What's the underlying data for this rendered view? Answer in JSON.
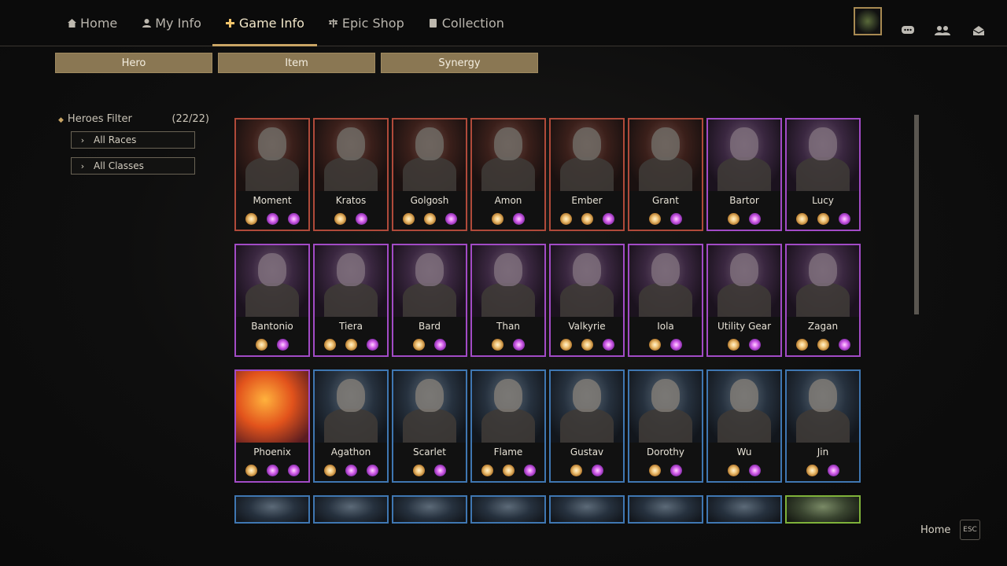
{
  "nav": {
    "items": [
      {
        "label": "Home",
        "icon": "home-icon"
      },
      {
        "label": "My Info",
        "icon": "user-icon"
      },
      {
        "label": "Game Info",
        "icon": "cross-icon",
        "active": true
      },
      {
        "label": "Epic Shop",
        "icon": "scale-icon"
      },
      {
        "label": "Collection",
        "icon": "book-icon"
      }
    ]
  },
  "subtabs": [
    "Hero",
    "Item",
    "Synergy"
  ],
  "filter": {
    "title": "Heroes Filter",
    "count": "(22/22)",
    "races": "All Races",
    "classes": "All Classes"
  },
  "heroes": [
    {
      "name": "Moment",
      "rarity": "red",
      "syn": [
        "o",
        "p",
        "p"
      ]
    },
    {
      "name": "Kratos",
      "rarity": "red",
      "syn": [
        "o",
        "p"
      ]
    },
    {
      "name": "Golgosh",
      "rarity": "red",
      "syn": [
        "o",
        "o",
        "p"
      ]
    },
    {
      "name": "Amon",
      "rarity": "red",
      "syn": [
        "o",
        "p"
      ]
    },
    {
      "name": "Ember",
      "rarity": "red",
      "syn": [
        "o",
        "o",
        "p"
      ]
    },
    {
      "name": "Grant",
      "rarity": "red",
      "syn": [
        "o",
        "p"
      ]
    },
    {
      "name": "Bartor",
      "rarity": "purple",
      "syn": [
        "o",
        "p"
      ]
    },
    {
      "name": "Lucy",
      "rarity": "purple",
      "syn": [
        "o",
        "o",
        "p"
      ]
    },
    {
      "name": "Bantonio",
      "rarity": "purple",
      "syn": [
        "o",
        "p"
      ]
    },
    {
      "name": "Tiera",
      "rarity": "purple",
      "syn": [
        "o",
        "o",
        "p"
      ]
    },
    {
      "name": "Bard",
      "rarity": "purple",
      "syn": [
        "o",
        "p"
      ]
    },
    {
      "name": "Than",
      "rarity": "purple",
      "syn": [
        "o",
        "p"
      ]
    },
    {
      "name": "Valkyrie",
      "rarity": "purple",
      "syn": [
        "o",
        "o",
        "p"
      ]
    },
    {
      "name": "Iola",
      "rarity": "purple",
      "syn": [
        "o",
        "p"
      ]
    },
    {
      "name": "Utility Gear",
      "rarity": "purple",
      "syn": [
        "o",
        "p"
      ]
    },
    {
      "name": "Zagan",
      "rarity": "purple",
      "syn": [
        "o",
        "o",
        "p"
      ]
    },
    {
      "name": "Phoenix",
      "rarity": "purple",
      "syn": [
        "o",
        "p",
        "p"
      ],
      "phoenix": true
    },
    {
      "name": "Agathon",
      "rarity": "blue",
      "syn": [
        "o",
        "p",
        "p"
      ]
    },
    {
      "name": "Scarlet",
      "rarity": "blue",
      "syn": [
        "o",
        "p"
      ]
    },
    {
      "name": "Flame",
      "rarity": "blue",
      "syn": [
        "o",
        "o",
        "p"
      ]
    },
    {
      "name": "Gustav",
      "rarity": "blue",
      "syn": [
        "o",
        "p"
      ]
    },
    {
      "name": "Dorothy",
      "rarity": "blue",
      "syn": [
        "o",
        "p"
      ]
    },
    {
      "name": "Wu",
      "rarity": "blue",
      "syn": [
        "o",
        "p"
      ]
    },
    {
      "name": "Jin",
      "rarity": "blue",
      "syn": [
        "o",
        "p"
      ]
    }
  ],
  "partial_row": [
    "blue",
    "blue",
    "blue",
    "blue",
    "blue",
    "blue",
    "blue",
    "green"
  ],
  "footer": {
    "home": "Home",
    "esc": "ESC"
  },
  "colors": {
    "accent": "#c9a565",
    "tab_bg": "#8a7753",
    "red_border": "#b04a3a",
    "purple_border": "#a24bc6",
    "blue_border": "#3f77b2",
    "green_border": "#7fb23a"
  }
}
